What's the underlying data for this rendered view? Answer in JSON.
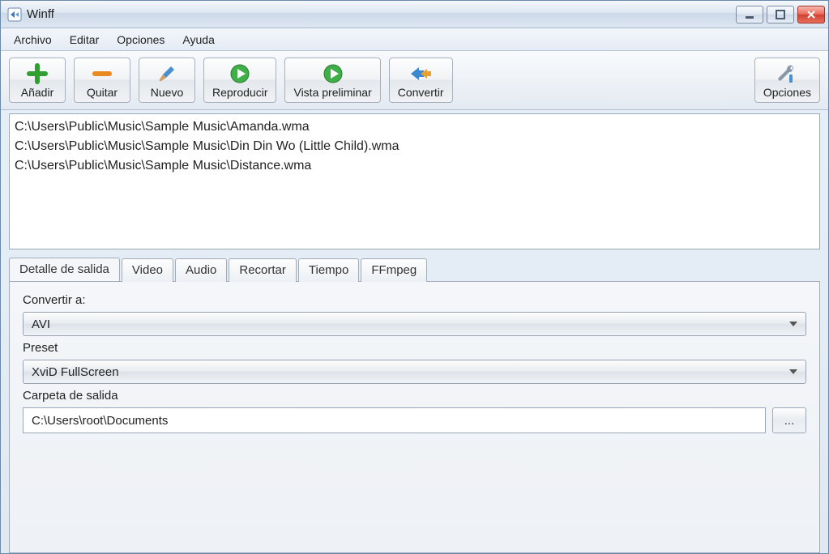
{
  "window": {
    "title": "Winff"
  },
  "menu": {
    "file": "Archivo",
    "edit": "Editar",
    "options": "Opciones",
    "help": "Ayuda"
  },
  "toolbar": {
    "add": "Añadir",
    "remove": "Quitar",
    "new": "Nuevo",
    "play": "Reproducir",
    "preview": "Vista preliminar",
    "convert": "Convertir",
    "options": "Opciones"
  },
  "files": [
    "C:\\Users\\Public\\Music\\Sample Music\\Amanda.wma",
    "C:\\Users\\Public\\Music\\Sample Music\\Din Din Wo (Little Child).wma",
    "C:\\Users\\Public\\Music\\Sample Music\\Distance.wma"
  ],
  "tabs": {
    "output": "Detalle de salida",
    "video": "Video",
    "audio": "Audio",
    "crop": "Recortar",
    "time": "Tiempo",
    "ffmpeg": "FFmpeg"
  },
  "output": {
    "convert_to_label": "Convertir a:",
    "convert_to_value": "AVI",
    "preset_label": "Preset",
    "preset_value": "XviD FullScreen",
    "folder_label": "Carpeta de salida",
    "folder_value": "C:\\Users\\root\\Documents",
    "browse_label": "..."
  }
}
